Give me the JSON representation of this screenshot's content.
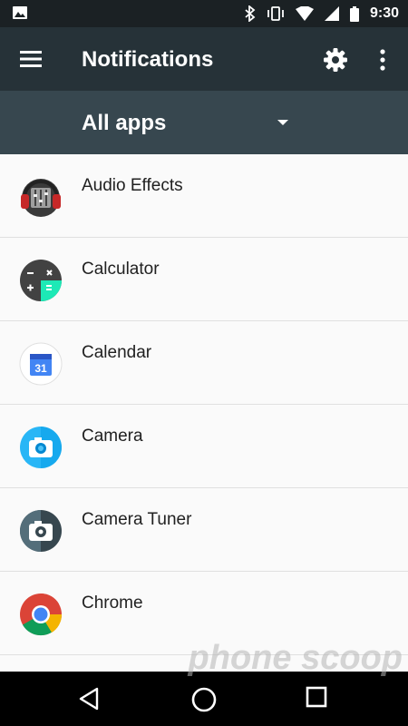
{
  "statusbar": {
    "time": "9:30"
  },
  "toolbar": {
    "title": "Notifications"
  },
  "filter": {
    "label": "All apps"
  },
  "apps": [
    {
      "name": "Audio Effects",
      "icon": "audio-effects-icon"
    },
    {
      "name": "Calculator",
      "icon": "calculator-icon"
    },
    {
      "name": "Calendar",
      "icon": "calendar-icon",
      "icon_text": "31"
    },
    {
      "name": "Camera",
      "icon": "camera-icon"
    },
    {
      "name": "Camera Tuner",
      "icon": "camera-tuner-icon"
    },
    {
      "name": "Chrome",
      "icon": "chrome-icon"
    }
  ],
  "watermark": "phone scoop",
  "colors": {
    "toolbar": "#263238",
    "subbar": "#37474f",
    "statusbar": "#1b2124",
    "list_bg": "#fafafa"
  }
}
